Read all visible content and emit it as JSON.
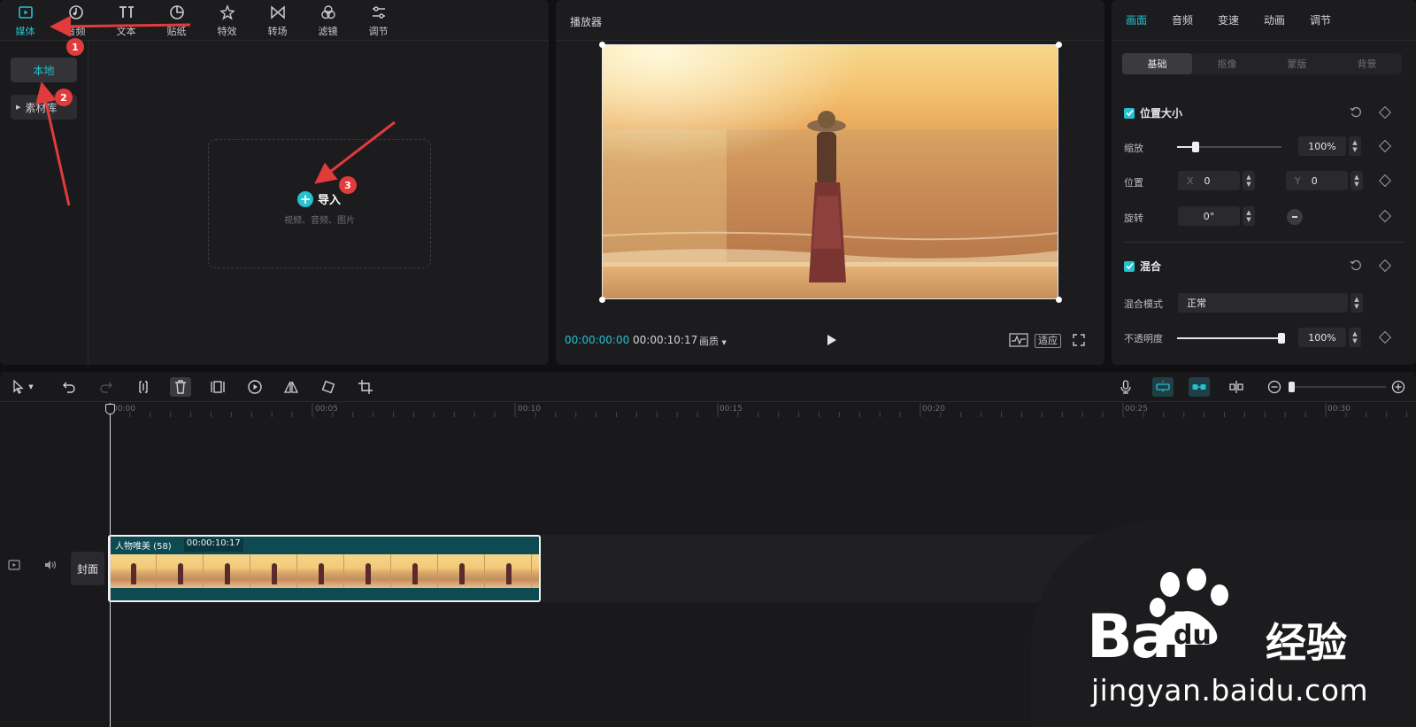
{
  "media_panel": {
    "tabs": [
      {
        "label": "媒体",
        "icon": "media-icon",
        "active": true
      },
      {
        "label": "音频",
        "icon": "audio-icon"
      },
      {
        "label": "文本",
        "icon": "text-icon"
      },
      {
        "label": "贴纸",
        "icon": "sticker-icon"
      },
      {
        "label": "特效",
        "icon": "effects-icon"
      },
      {
        "label": "转场",
        "icon": "transition-icon"
      },
      {
        "label": "滤镜",
        "icon": "filter-icon"
      },
      {
        "label": "调节",
        "icon": "adjust-icon"
      }
    ],
    "side_nav": {
      "local": "本地",
      "library": "素材库"
    },
    "import": {
      "label": "导入",
      "hint": "视频、音频、图片"
    },
    "annotations": [
      "1",
      "2",
      "3"
    ]
  },
  "player": {
    "title": "播放器",
    "current_time": "00:00:00:00",
    "total_time": "00:00:10:17",
    "quality": "画质",
    "fit": "适应"
  },
  "properties": {
    "tabs": [
      "画面",
      "音频",
      "变速",
      "动画",
      "调节"
    ],
    "sub_tabs": [
      "基础",
      "抠像",
      "蒙版",
      "背景"
    ],
    "position_size": {
      "title": "位置大小",
      "scale_label": "缩放",
      "scale_value": "100%",
      "scale_fraction": 0.18,
      "position_label": "位置",
      "x_prefix": "X",
      "x_value": "0",
      "y_prefix": "Y",
      "y_value": "0",
      "rotate_label": "旋转",
      "rotate_value": "0°"
    },
    "blend": {
      "title": "混合",
      "mode_label": "混合模式",
      "mode_value": "正常",
      "opacity_label": "不透明度",
      "opacity_value": "100%",
      "opacity_fraction": 1.0
    }
  },
  "timeline": {
    "ruler": [
      "00:00",
      "00:05",
      "00:10",
      "00:15",
      "00:20",
      "00:25",
      "00:30"
    ],
    "clip": {
      "name": "人物唯美 (58)",
      "duration": "00:00:10:17"
    },
    "cover_label": "封面"
  },
  "watermark": {
    "brand": "Bai",
    "du": "du",
    "cn": "经验",
    "url": "jingyan.baidu.com"
  },
  "colors": {
    "accent": "#24c1cf",
    "annotation": "#e23b3b",
    "clip": "#0e4a52"
  }
}
